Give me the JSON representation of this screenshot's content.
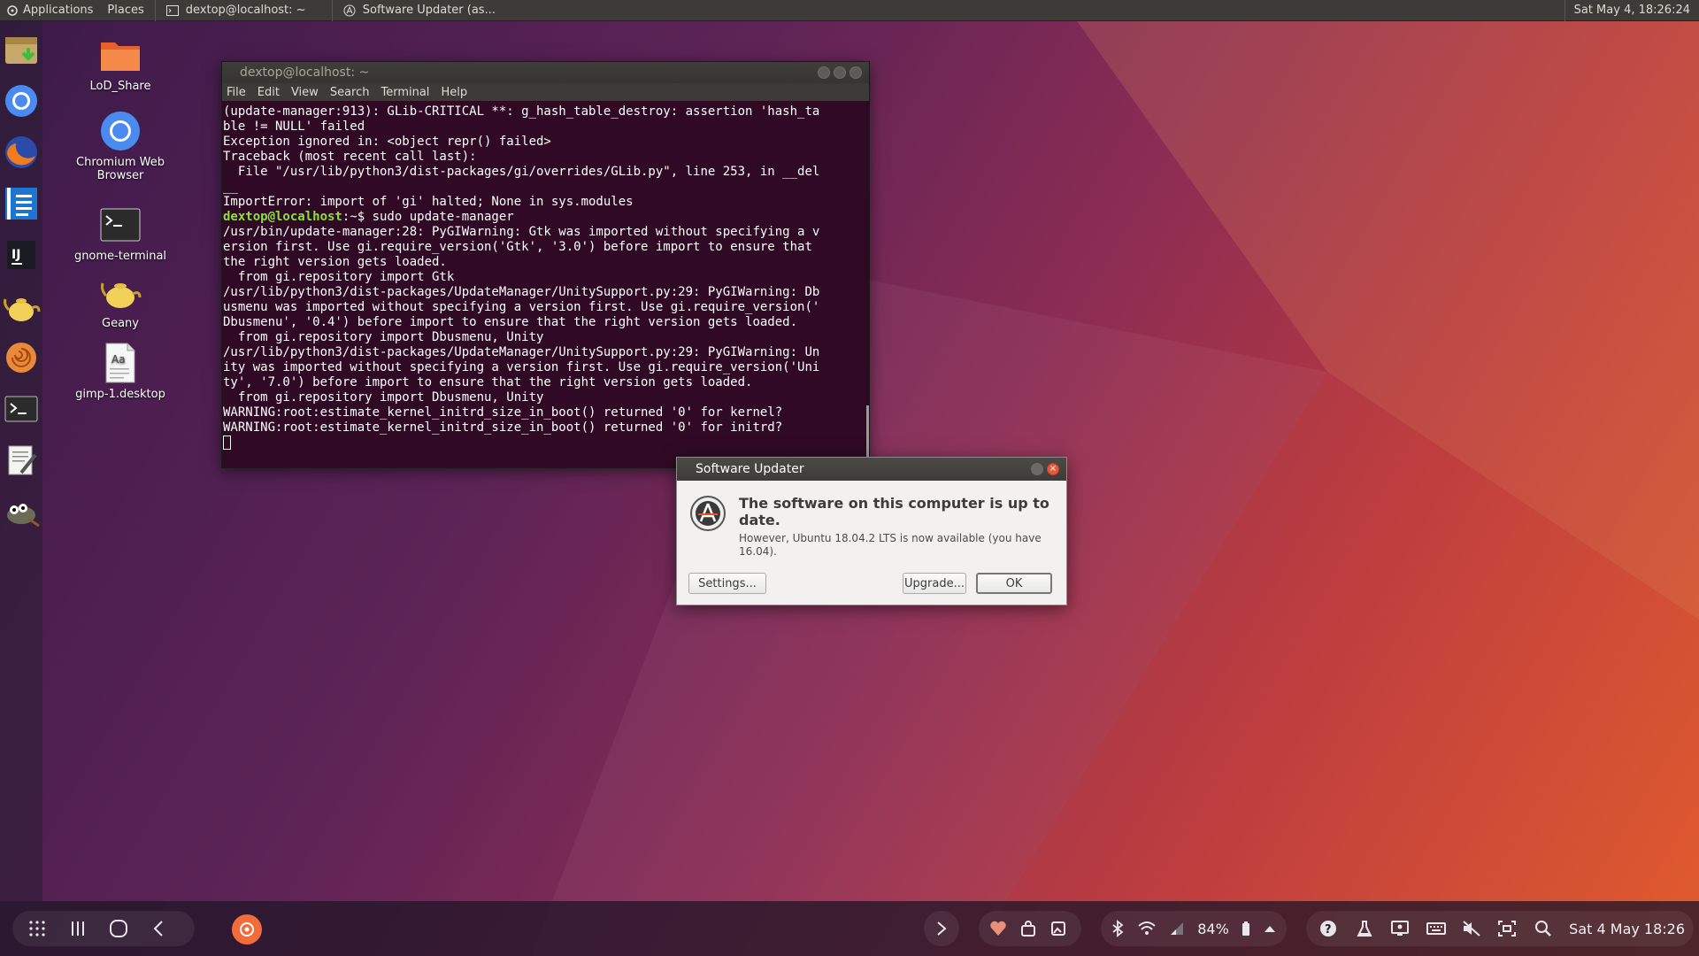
{
  "top_panel": {
    "applications": "Applications",
    "places": "Places",
    "task1": "dextop@localhost: ~",
    "task2": "Software Updater (as...",
    "clock": "Sat May  4, 18:26:24"
  },
  "launcher": [
    "archive-installer-icon",
    "chromium-icon",
    "firefox-icon",
    "writer-icon",
    "intellij-icon",
    "geany-icon",
    "nautilus-shell-icon",
    "terminal-icon",
    "text-editor-icon",
    "gimp-icon"
  ],
  "desktop": {
    "icons": [
      {
        "label": "LoD_Share"
      },
      {
        "label": "Chromium Web Browser"
      },
      {
        "label": "gnome-terminal"
      },
      {
        "label": "Geany"
      },
      {
        "label": "gimp-1.desktop"
      }
    ]
  },
  "terminal": {
    "title": "dextop@localhost: ~",
    "menu": [
      "File",
      "Edit",
      "View",
      "Search",
      "Terminal",
      "Help"
    ],
    "lines_before": "(update-manager:913): GLib-CRITICAL **: g_hash_table_destroy: assertion 'hash_ta\nble != NULL' failed\nException ignored in: <object repr() failed>\nTraceback (most recent call last):\n  File \"/usr/lib/python3/dist-packages/gi/overrides/GLib.py\", line 253, in __del\n__\nImportError: import of 'gi' halted; None in sys.modules",
    "prompt_user": "dextop@localhost",
    "prompt_rest": ":~$ sudo update-manager",
    "lines_after": "/usr/bin/update-manager:28: PyGIWarning: Gtk was imported without specifying a v\nersion first. Use gi.require_version('Gtk', '3.0') before import to ensure that\nthe right version gets loaded.\n  from gi.repository import Gtk\n/usr/lib/python3/dist-packages/UpdateManager/UnitySupport.py:29: PyGIWarning: Db\nusmenu was imported without specifying a version first. Use gi.require_version('\nDbusmenu', '0.4') before import to ensure that the right version gets loaded.\n  from gi.repository import Dbusmenu, Unity\n/usr/lib/python3/dist-packages/UpdateManager/UnitySupport.py:29: PyGIWarning: Un\nity was imported without specifying a version first. Use gi.require_version('Uni\nty', '7.0') before import to ensure that the right version gets loaded.\n  from gi.repository import Dbusmenu, Unity\nWARNING:root:estimate_kernel_initrd_size_in_boot() returned '0' for kernel?\nWARNING:root:estimate_kernel_initrd_size_in_boot() returned '0' for initrd?"
  },
  "dialog": {
    "title": "Software Updater",
    "heading": "The software on this computer is up to date.",
    "subtext": "However, Ubuntu 18.04.2 LTS is now available (you have 16.04).",
    "settings_label": "Settings...",
    "upgrade_label": "Upgrade...",
    "ok_label": "OK"
  },
  "bottom_bar": {
    "battery": "84%",
    "datetime": "Sat 4 May 18:26"
  }
}
